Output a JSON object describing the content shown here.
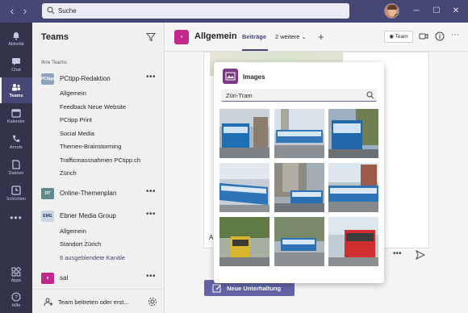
{
  "titlebar": {
    "search_placeholder": "Suche",
    "accent": "#464775"
  },
  "rail": {
    "items": [
      {
        "label": "Aktivität",
        "icon": "bell-icon"
      },
      {
        "label": "Chat",
        "icon": "chat-icon"
      },
      {
        "label": "Teams",
        "icon": "teams-icon",
        "active": true
      },
      {
        "label": "Kalender",
        "icon": "calendar-icon"
      },
      {
        "label": "Anrufe",
        "icon": "phone-icon"
      },
      {
        "label": "Dateien",
        "icon": "files-icon"
      },
      {
        "label": "Schichten",
        "icon": "shifts-icon"
      },
      {
        "label": "Apps",
        "icon": "apps-icon"
      },
      {
        "label": "Hilfe",
        "icon": "help-icon"
      }
    ]
  },
  "teams_panel": {
    "title": "Teams",
    "section_label": "Ihre Teams",
    "teams": [
      {
        "name": "PCtipp-Redaktion",
        "logo_text": "PCtipp",
        "logo_color": "#8fa3bf",
        "channels": [
          "Allgemein",
          "Feedback Neue Website",
          "PCtipp Print",
          "Social Media",
          "Themen-Brainstorming",
          "Trafficmassnahmen PCtipp.ch",
          "Zürich"
        ]
      },
      {
        "name": "Online-Themenplan",
        "logo_text": "OT",
        "logo_color": "#5b8a8c",
        "channels": []
      },
      {
        "name": "Ebner Media Group",
        "logo_text": "EMG",
        "logo_color": "#c9d6e4",
        "channels": [
          "Allgemein",
          "Standort Zürich"
        ],
        "hidden_channels_link": "6 ausgeblendete Kanäle"
      },
      {
        "name": "sal",
        "logo_text": "s",
        "logo_color": "#c4288a",
        "channels": []
      }
    ],
    "footer_label": "Team beitreten oder erst..."
  },
  "channel_header": {
    "title": "Allgemein",
    "logo_text": "s",
    "tabs": [
      "Beiträge",
      "2 weitere"
    ],
    "team_button": "Team"
  },
  "chat": {
    "reply_prefix": "A",
    "new_conversation_label": "Neue Unterhaltung"
  },
  "images_popup": {
    "title": "Images",
    "search_value": "Züri-Tram",
    "thumbnails": [
      {
        "alt": "tram-1"
      },
      {
        "alt": "tram-2"
      },
      {
        "alt": "tram-3"
      },
      {
        "alt": "tram-4"
      },
      {
        "alt": "tram-5"
      },
      {
        "alt": "tram-6"
      },
      {
        "alt": "tram-7"
      },
      {
        "alt": "tram-8"
      },
      {
        "alt": "tram-9"
      }
    ]
  }
}
